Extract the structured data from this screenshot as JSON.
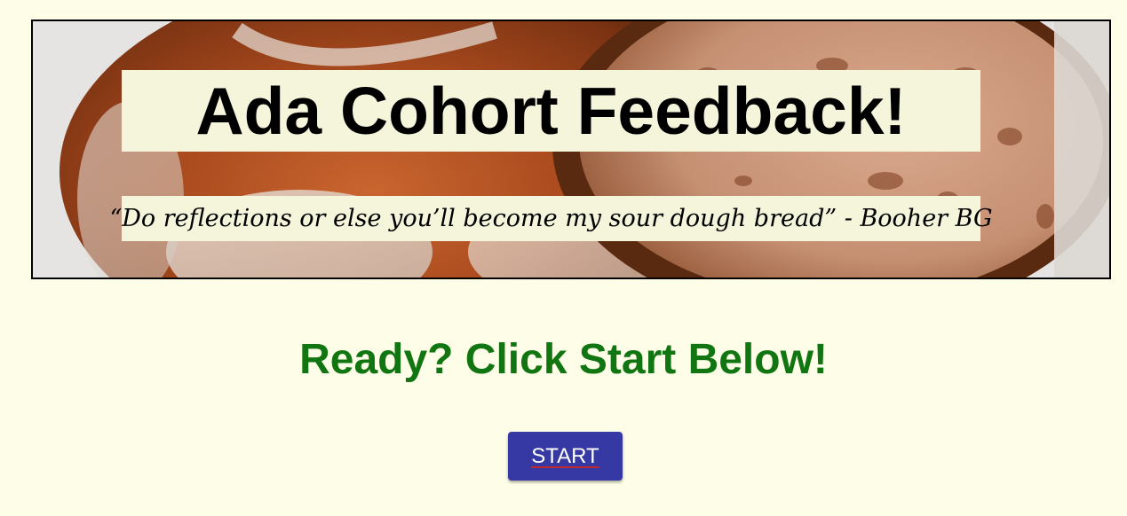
{
  "hero": {
    "title": "Ada Cohort Feedback!",
    "quote": "“Do reflections or else you’ll become my sour dough bread” - Booher BG",
    "image_subject": "sourdough-bread-image"
  },
  "main": {
    "prompt": "Ready? Click Start Below!",
    "start_label": "START"
  },
  "colors": {
    "background": "#fefee8",
    "prompt_text": "#117511",
    "button_bg": "#3639a4",
    "banner_box": "#f5f5dc"
  }
}
